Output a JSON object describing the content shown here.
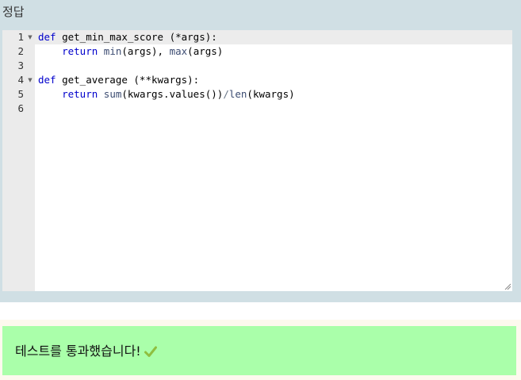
{
  "answer": {
    "title": "정답",
    "lines": [
      {
        "number": "1",
        "foldable": true,
        "tokens": [
          {
            "t": "def",
            "c": "kw"
          },
          {
            "t": " get_min_max_score (*args):",
            "c": ""
          }
        ]
      },
      {
        "number": "2",
        "foldable": false,
        "tokens": [
          {
            "t": "    ",
            "c": ""
          },
          {
            "t": "return",
            "c": "kw"
          },
          {
            "t": " ",
            "c": ""
          },
          {
            "t": "min",
            "c": "bi"
          },
          {
            "t": "(args), ",
            "c": ""
          },
          {
            "t": "max",
            "c": "bi"
          },
          {
            "t": "(args)",
            "c": ""
          }
        ]
      },
      {
        "number": "3",
        "foldable": false,
        "tokens": []
      },
      {
        "number": "4",
        "foldable": true,
        "tokens": [
          {
            "t": "def",
            "c": "kw"
          },
          {
            "t": " get_average (**kwargs):",
            "c": ""
          }
        ]
      },
      {
        "number": "5",
        "foldable": false,
        "tokens": [
          {
            "t": "    ",
            "c": ""
          },
          {
            "t": "return",
            "c": "kw"
          },
          {
            "t": " ",
            "c": ""
          },
          {
            "t": "sum",
            "c": "bi"
          },
          {
            "t": "(kwargs.values())",
            "c": ""
          },
          {
            "t": "/",
            "c": "op"
          },
          {
            "t": "len",
            "c": "bi"
          },
          {
            "t": "(kwargs)",
            "c": ""
          }
        ]
      },
      {
        "number": "6",
        "foldable": false,
        "tokens": []
      }
    ]
  },
  "result": {
    "message": "테스트를 통과했습니다!",
    "icon": "check-icon",
    "icon_color": "#8fbf3f",
    "background": "#aaffaa"
  },
  "colors": {
    "panel_bg": "#d0dfe4",
    "keyword": "#0000cc",
    "builtin": "#3c4c72"
  }
}
